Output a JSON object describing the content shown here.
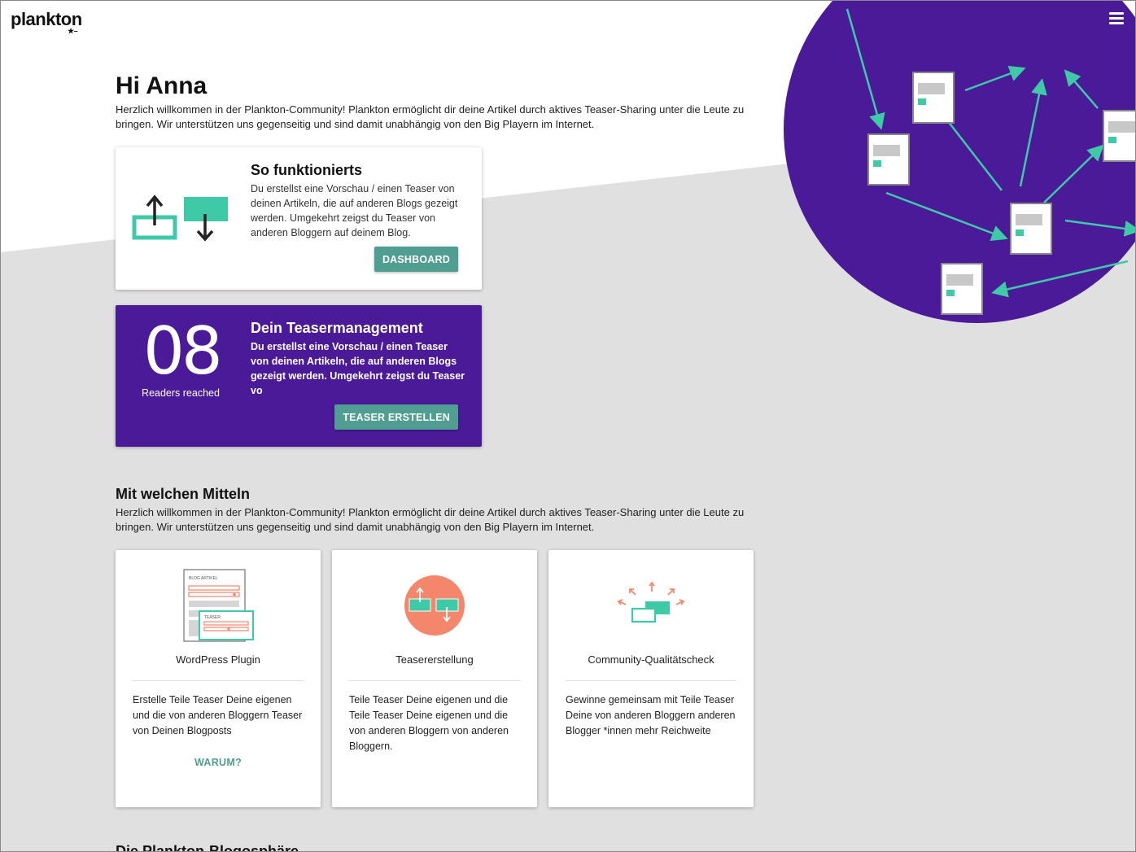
{
  "brand": {
    "logo_text": "plankton",
    "logo_star": "★–"
  },
  "colors": {
    "purple": "#4a1a99",
    "teal": "#3ec9a7",
    "button": "#4f9e91",
    "salmon": "#f4876b",
    "grey_bg": "#e0e0e0"
  },
  "header": {
    "menu_icon": "hamburger-menu-icon"
  },
  "greeting": {
    "title": "Hi Anna",
    "intro": "Herzlich willkommen in der Plankton-Community! Plankton ermöglicht dir deine Artikel durch aktives Teaser-Sharing unter die Leute zu bringen. Wir unterstützen uns gegenseitig und sind damit unabhängig von den Big Playern im Internet."
  },
  "how_card": {
    "title": "So funktionierts",
    "text": "Du erstellst eine Vorschau / einen Teaser von deinen Artikeln, die auf anderen Blogs gezeigt werden. Umgekehrt zeigst du Teaser von anderen Bloggern auf deinem Blog.",
    "button": "DASHBOARD",
    "icon": "teaser-exchange-icon"
  },
  "teaser_card": {
    "number": "08",
    "caption": "Readers reached",
    "title": "Dein Teasermanagement",
    "text": "Du erstellst eine Vorschau / einen Teaser von deinen Artikeln, die auf anderen Blogs gezeigt werden. Umgekehrt zeigst du Teaser vo",
    "button": "TEASER ERSTELLEN"
  },
  "means": {
    "title": "Mit welchen Mitteln",
    "intro": "Herzlich willkommen in der Plankton-Community! Plankton ermöglicht dir deine Artikel durch aktives Teaser-Sharing unter die Leute zu bringen. Wir unterstützen uns gegenseitig und sind damit unabhängig von den Big Playern im Internet.",
    "features": [
      {
        "title": "WordPress Plugin",
        "icon": "blog-article-icon",
        "illus_label_article": "BLOG ARTIKEL",
        "illus_label_teaser": "TEASER",
        "text": "Erstelle Teile Teaser Deine eigenen und die von anderen Bloggern Teaser von Deinen Blogposts",
        "link": "WARUM?"
      },
      {
        "title": "Teasererstellung",
        "icon": "teaser-creation-icon",
        "text": "Teile Teaser Deine eigenen und die Teile Teaser Deine eigenen und die von anderen Bloggern von anderen Bloggern."
      },
      {
        "title": "Community-Qualitätscheck",
        "icon": "community-check-icon",
        "text": "Gewinne gemeinsam mit Teile Teaser Deine von anderen Bloggern anderen Blogger *innen mehr Reichweite"
      }
    ]
  },
  "sphere": {
    "title": "Die Plankton-Blogosphäre"
  }
}
